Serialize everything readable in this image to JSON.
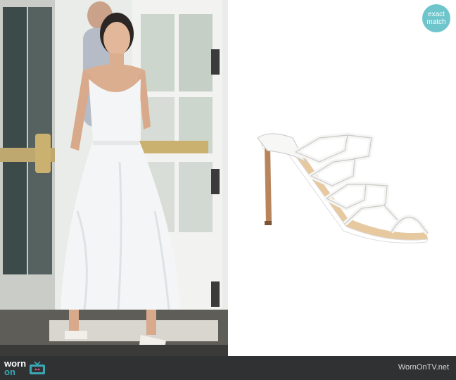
{
  "badge": {
    "line1": "exact",
    "line2": "match"
  },
  "footer": {
    "logo_word1": "worn",
    "logo_word2": "on",
    "site": "WornOnTV.net"
  },
  "icons": [
    "tv-icon"
  ],
  "colors": {
    "badge": "#6ec6cc",
    "footer_bg": "#2f3133",
    "logo_accent": "#3aa7b4"
  }
}
